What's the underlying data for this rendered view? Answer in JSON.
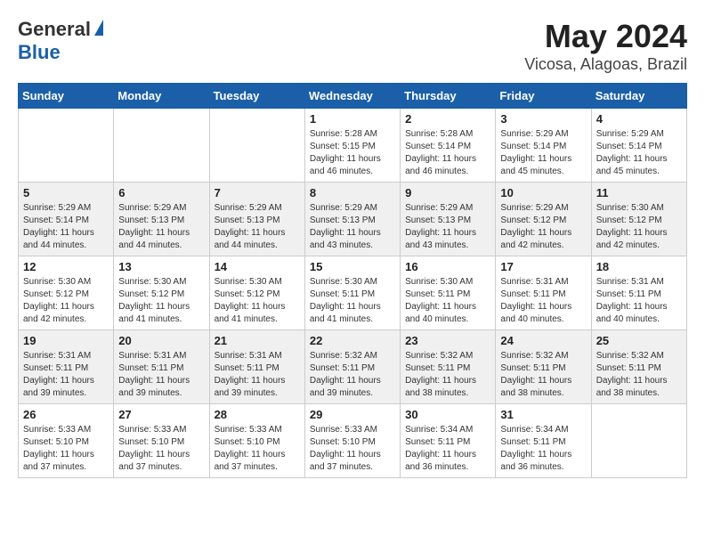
{
  "header": {
    "logo_general": "General",
    "logo_blue": "Blue",
    "title": "May 2024",
    "subtitle": "Vicosa, Alagoas, Brazil"
  },
  "days_of_week": [
    "Sunday",
    "Monday",
    "Tuesday",
    "Wednesday",
    "Thursday",
    "Friday",
    "Saturday"
  ],
  "weeks": [
    [
      {
        "day": "",
        "info": ""
      },
      {
        "day": "",
        "info": ""
      },
      {
        "day": "",
        "info": ""
      },
      {
        "day": "1",
        "info": "Sunrise: 5:28 AM\nSunset: 5:15 PM\nDaylight: 11 hours\nand 46 minutes."
      },
      {
        "day": "2",
        "info": "Sunrise: 5:28 AM\nSunset: 5:14 PM\nDaylight: 11 hours\nand 46 minutes."
      },
      {
        "day": "3",
        "info": "Sunrise: 5:29 AM\nSunset: 5:14 PM\nDaylight: 11 hours\nand 45 minutes."
      },
      {
        "day": "4",
        "info": "Sunrise: 5:29 AM\nSunset: 5:14 PM\nDaylight: 11 hours\nand 45 minutes."
      }
    ],
    [
      {
        "day": "5",
        "info": "Sunrise: 5:29 AM\nSunset: 5:14 PM\nDaylight: 11 hours\nand 44 minutes."
      },
      {
        "day": "6",
        "info": "Sunrise: 5:29 AM\nSunset: 5:13 PM\nDaylight: 11 hours\nand 44 minutes."
      },
      {
        "day": "7",
        "info": "Sunrise: 5:29 AM\nSunset: 5:13 PM\nDaylight: 11 hours\nand 44 minutes."
      },
      {
        "day": "8",
        "info": "Sunrise: 5:29 AM\nSunset: 5:13 PM\nDaylight: 11 hours\nand 43 minutes."
      },
      {
        "day": "9",
        "info": "Sunrise: 5:29 AM\nSunset: 5:13 PM\nDaylight: 11 hours\nand 43 minutes."
      },
      {
        "day": "10",
        "info": "Sunrise: 5:29 AM\nSunset: 5:12 PM\nDaylight: 11 hours\nand 42 minutes."
      },
      {
        "day": "11",
        "info": "Sunrise: 5:30 AM\nSunset: 5:12 PM\nDaylight: 11 hours\nand 42 minutes."
      }
    ],
    [
      {
        "day": "12",
        "info": "Sunrise: 5:30 AM\nSunset: 5:12 PM\nDaylight: 11 hours\nand 42 minutes."
      },
      {
        "day": "13",
        "info": "Sunrise: 5:30 AM\nSunset: 5:12 PM\nDaylight: 11 hours\nand 41 minutes."
      },
      {
        "day": "14",
        "info": "Sunrise: 5:30 AM\nSunset: 5:12 PM\nDaylight: 11 hours\nand 41 minutes."
      },
      {
        "day": "15",
        "info": "Sunrise: 5:30 AM\nSunset: 5:11 PM\nDaylight: 11 hours\nand 41 minutes."
      },
      {
        "day": "16",
        "info": "Sunrise: 5:30 AM\nSunset: 5:11 PM\nDaylight: 11 hours\nand 40 minutes."
      },
      {
        "day": "17",
        "info": "Sunrise: 5:31 AM\nSunset: 5:11 PM\nDaylight: 11 hours\nand 40 minutes."
      },
      {
        "day": "18",
        "info": "Sunrise: 5:31 AM\nSunset: 5:11 PM\nDaylight: 11 hours\nand 40 minutes."
      }
    ],
    [
      {
        "day": "19",
        "info": "Sunrise: 5:31 AM\nSunset: 5:11 PM\nDaylight: 11 hours\nand 39 minutes."
      },
      {
        "day": "20",
        "info": "Sunrise: 5:31 AM\nSunset: 5:11 PM\nDaylight: 11 hours\nand 39 minutes."
      },
      {
        "day": "21",
        "info": "Sunrise: 5:31 AM\nSunset: 5:11 PM\nDaylight: 11 hours\nand 39 minutes."
      },
      {
        "day": "22",
        "info": "Sunrise: 5:32 AM\nSunset: 5:11 PM\nDaylight: 11 hours\nand 39 minutes."
      },
      {
        "day": "23",
        "info": "Sunrise: 5:32 AM\nSunset: 5:11 PM\nDaylight: 11 hours\nand 38 minutes."
      },
      {
        "day": "24",
        "info": "Sunrise: 5:32 AM\nSunset: 5:11 PM\nDaylight: 11 hours\nand 38 minutes."
      },
      {
        "day": "25",
        "info": "Sunrise: 5:32 AM\nSunset: 5:11 PM\nDaylight: 11 hours\nand 38 minutes."
      }
    ],
    [
      {
        "day": "26",
        "info": "Sunrise: 5:33 AM\nSunset: 5:10 PM\nDaylight: 11 hours\nand 37 minutes."
      },
      {
        "day": "27",
        "info": "Sunrise: 5:33 AM\nSunset: 5:10 PM\nDaylight: 11 hours\nand 37 minutes."
      },
      {
        "day": "28",
        "info": "Sunrise: 5:33 AM\nSunset: 5:10 PM\nDaylight: 11 hours\nand 37 minutes."
      },
      {
        "day": "29",
        "info": "Sunrise: 5:33 AM\nSunset: 5:10 PM\nDaylight: 11 hours\nand 37 minutes."
      },
      {
        "day": "30",
        "info": "Sunrise: 5:34 AM\nSunset: 5:11 PM\nDaylight: 11 hours\nand 36 minutes."
      },
      {
        "day": "31",
        "info": "Sunrise: 5:34 AM\nSunset: 5:11 PM\nDaylight: 11 hours\nand 36 minutes."
      },
      {
        "day": "",
        "info": ""
      }
    ]
  ]
}
